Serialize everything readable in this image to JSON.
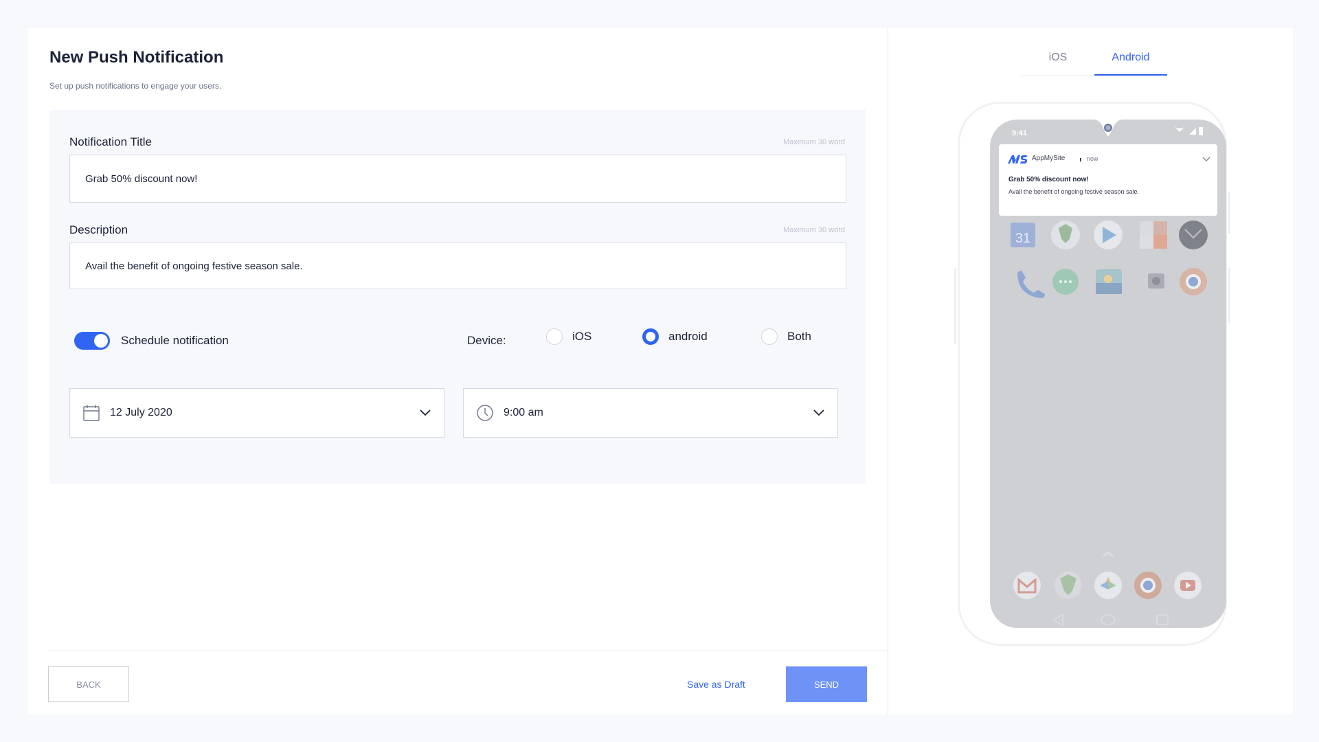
{
  "header": {
    "title": "New Push Notification",
    "subtitle": "Set up push notifications to engage your users."
  },
  "form": {
    "title_label": "Notification Title",
    "title_hint": "Maximum 30 word",
    "title_value": "Grab 50% discount now!",
    "description_label": "Description",
    "description_hint": "Maximum 30 word",
    "description_value": "Avail the benefit of ongoing festive season sale.",
    "schedule_label": "Schedule notification",
    "schedule_enabled": true,
    "device_label": "Device:",
    "device_options": [
      {
        "label": "iOS",
        "selected": false
      },
      {
        "label": "android",
        "selected": true
      },
      {
        "label": "Both",
        "selected": false
      }
    ],
    "date_value": "12 July 2020",
    "time_value": "9:00 am"
  },
  "footer": {
    "back_label": "BACK",
    "draft_label": "Save as Draft",
    "send_label": "SEND"
  },
  "preview": {
    "tabs": [
      {
        "label": "iOS",
        "active": false
      },
      {
        "label": "Android",
        "active": true
      }
    ],
    "status_time": "9:41",
    "notification": {
      "app_name": "AppMySite",
      "time": "now",
      "title": "Grab 50% discount now!",
      "description": "Avail the benefit of ongoing festive season sale."
    }
  },
  "colors": {
    "accent": "#3064f2",
    "send_button": "#6e92f6",
    "form_panel": "#f7f8fc",
    "phone_screen": "#cfd0d4"
  },
  "icons": {
    "date": "calendar-icon",
    "time": "clock-icon",
    "dropdown": "chevron-down-icon"
  }
}
